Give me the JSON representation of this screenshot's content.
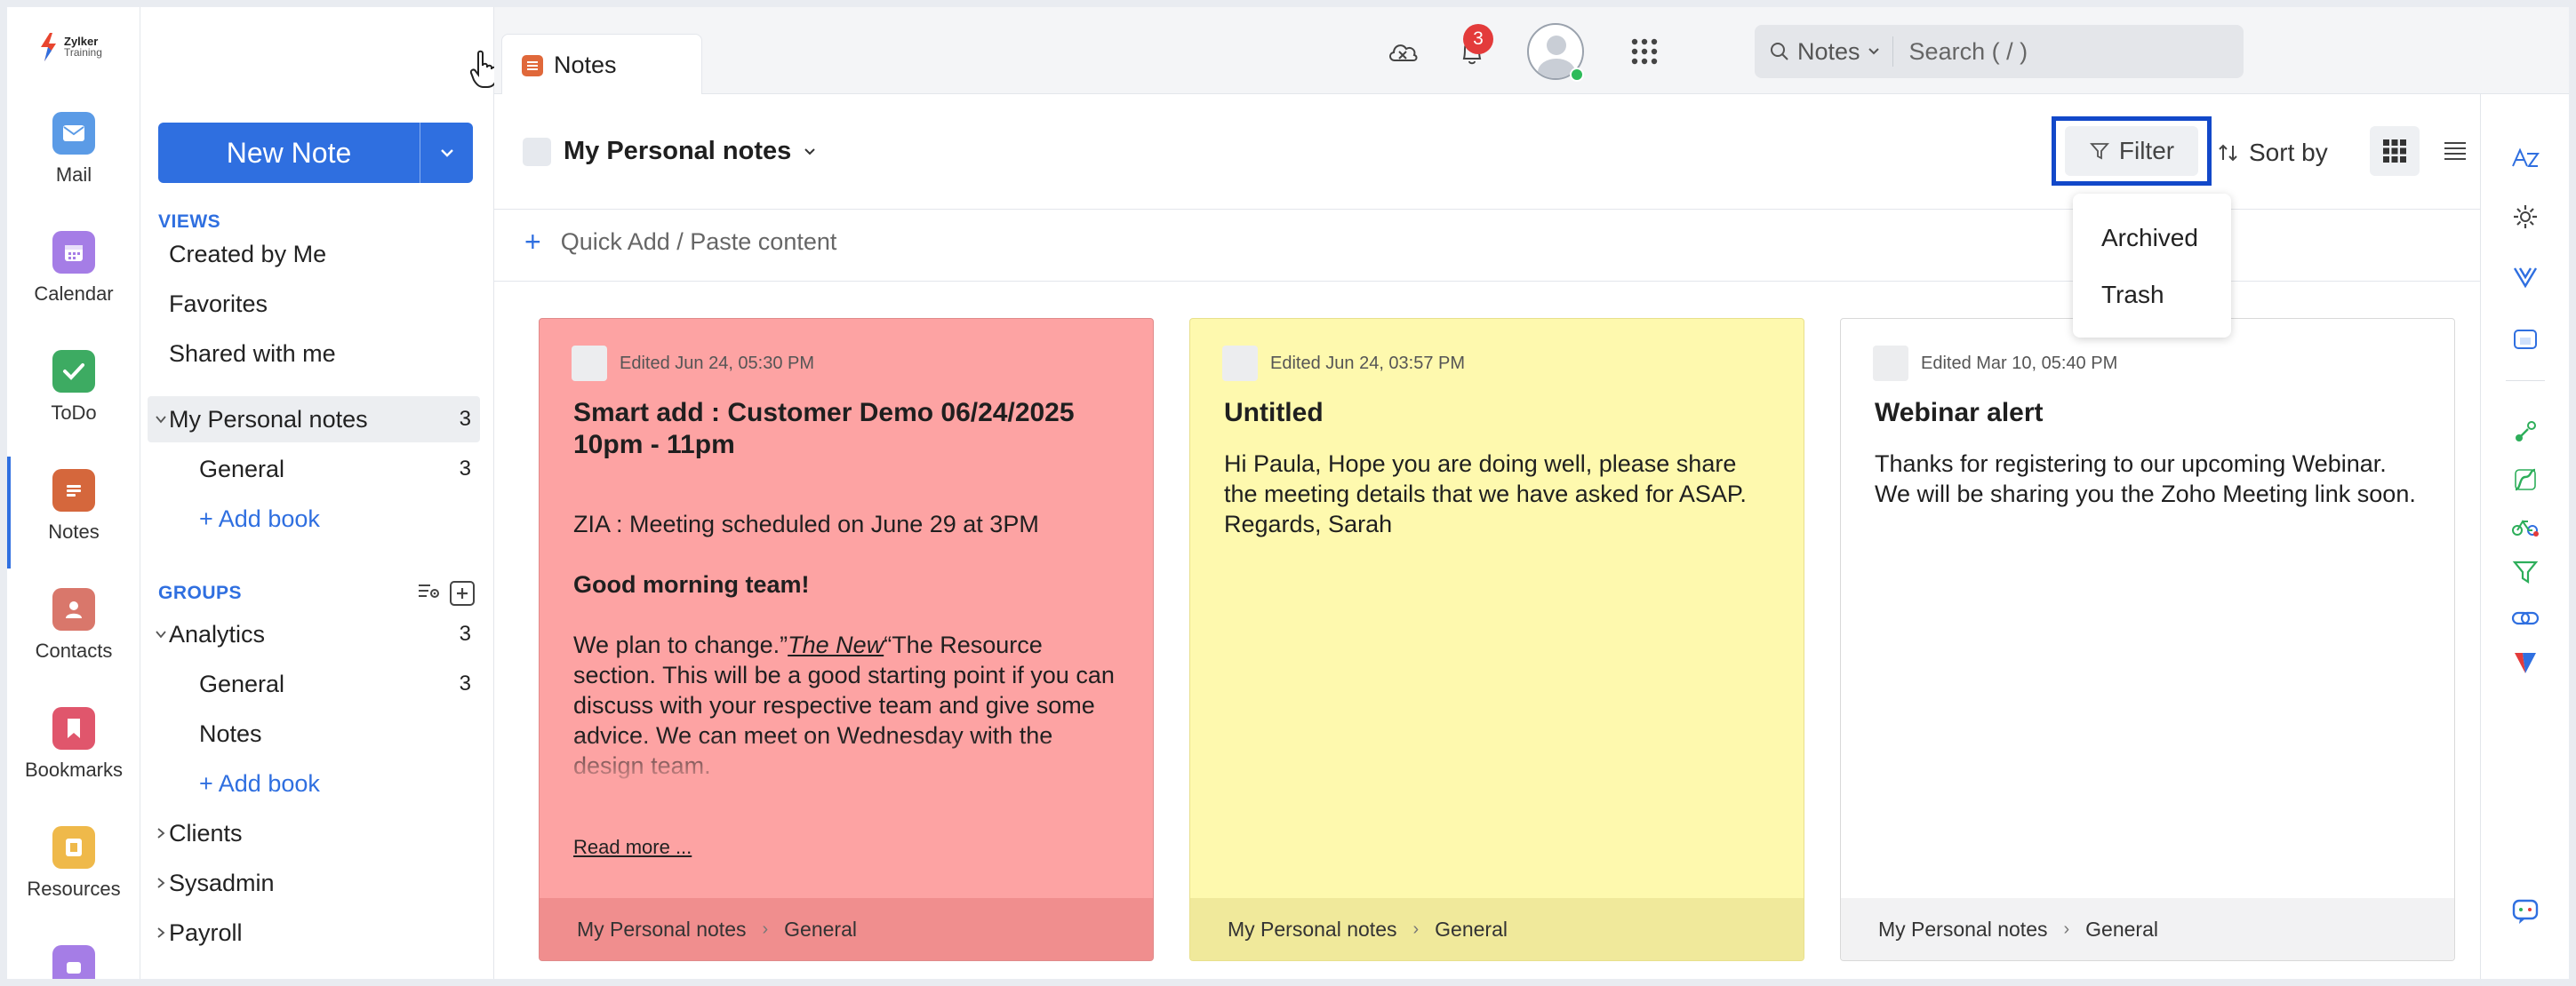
{
  "brand": {
    "name": "Zylker",
    "sub": "Training"
  },
  "rail": [
    {
      "label": "Mail",
      "color": "#5b9be6"
    },
    {
      "label": "Calendar",
      "color": "#a57de6"
    },
    {
      "label": "ToDo",
      "color": "#3dab62"
    },
    {
      "label": "Notes",
      "color": "#d5673c"
    },
    {
      "label": "Contacts",
      "color": "#d9776b"
    },
    {
      "label": "Bookmarks",
      "color": "#e0566c"
    },
    {
      "label": "Resources",
      "color": "#efb94a"
    }
  ],
  "sidebar": {
    "new_note": "New Note",
    "views_heading": "VIEWS",
    "views": [
      {
        "label": "Created by Me"
      },
      {
        "label": "Favorites"
      },
      {
        "label": "Shared with me"
      }
    ],
    "personal": {
      "label": "My Personal notes",
      "count": "3"
    },
    "personal_books": [
      {
        "label": "General",
        "count": "3"
      }
    ],
    "add_book": "+ Add book",
    "groups_heading": "GROUPS",
    "analytics": {
      "label": "Analytics",
      "count": "3"
    },
    "analytics_books": [
      {
        "label": "General",
        "count": "3"
      },
      {
        "label": "Notes",
        "count": ""
      }
    ],
    "add_book2": "+ Add book",
    "groups": [
      {
        "label": "Clients"
      },
      {
        "label": "Sysadmin"
      },
      {
        "label": "Payroll"
      }
    ]
  },
  "header": {
    "tab_label": "Notes",
    "search_scope": "Notes",
    "search_placeholder": "Search ( / )",
    "notification_count": "3"
  },
  "toolbar": {
    "notebook": "My Personal notes",
    "filter_label": "Filter",
    "sort_label": "Sort by",
    "quick_add": "Quick Add / Paste content"
  },
  "filter_menu": {
    "options": [
      "Archived",
      "Trash"
    ]
  },
  "notes": [
    {
      "edited": "Edited Jun 24, 05:30 PM",
      "title": "Smart add : Customer Demo 06/24/2025 10pm - 11pm",
      "line1": "ZIA : Meeting scheduled on June 29 at 3PM",
      "line2": "Good morning team!",
      "line3_pre": "We plan to change.”",
      "line3_link": "The New",
      "line3_post": "“The Resource section. This will be a good starting point if you can discuss with your respective team and give some advice. We can meet on Wednesday with the design team.",
      "read_more": "Read more ...",
      "breadcrumb": [
        "My Personal notes",
        "General"
      ],
      "bg": "#fda3a3",
      "footer_bg": "#f08e8e"
    },
    {
      "edited": "Edited Jun 24, 03:57 PM",
      "title": "Untitled",
      "text": "Hi Paula, Hope you are doing well, please share the meeting details that we have asked for ASAP. Regards, Sarah",
      "breadcrumb": [
        "My Personal notes",
        "General"
      ],
      "bg": "#fef9ae",
      "footer_bg": "#f0e99b"
    },
    {
      "edited": "Edited Mar 10, 05:40 PM",
      "title": "Webinar alert",
      "text": "Thanks for registering to our upcoming Webinar. We will be sharing you the Zoho Meeting link soon.",
      "breadcrumb": [
        "My Personal notes",
        "General"
      ],
      "bg": "#ffffff",
      "footer_bg": "#f2f2f3"
    }
  ]
}
